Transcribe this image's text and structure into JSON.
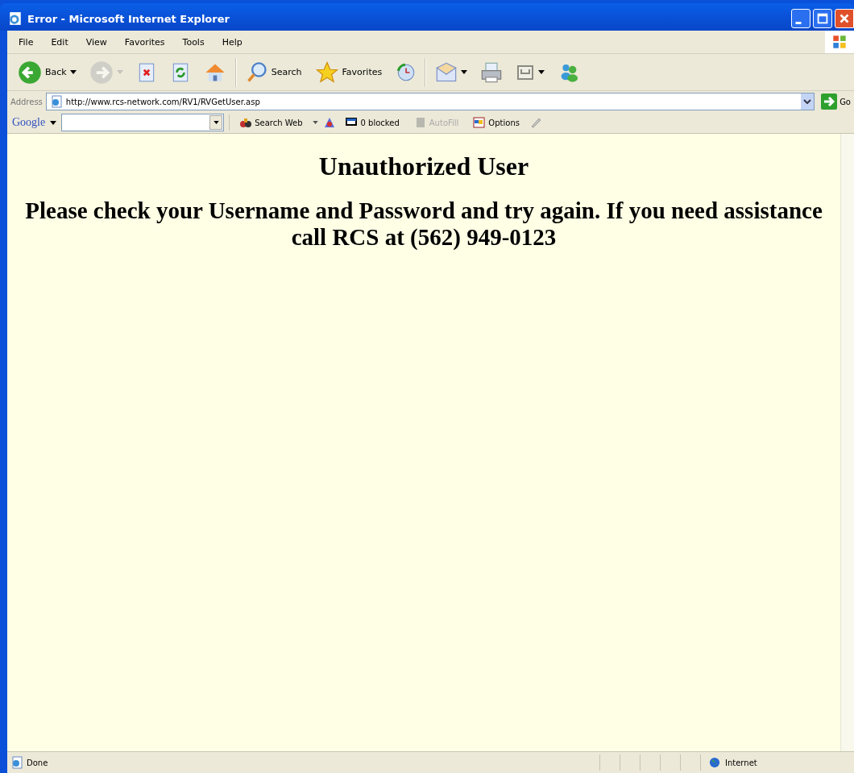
{
  "window": {
    "title": "Error - Microsoft Internet Explorer"
  },
  "menu": [
    "File",
    "Edit",
    "View",
    "Favorites",
    "Tools",
    "Help"
  ],
  "toolbar": [
    {
      "kind": "back",
      "label": "Back",
      "disabled": false,
      "dropdown": true
    },
    {
      "kind": "forward",
      "disabled": true,
      "dropdown": true
    },
    {
      "kind": "stop",
      "disabled": false,
      "dropdown": false
    },
    {
      "kind": "refresh",
      "disabled": false,
      "dropdown": false
    },
    {
      "kind": "home",
      "disabled": false,
      "dropdown": false
    },
    {
      "kind": "search",
      "label": "Search",
      "disabled": false,
      "dropdown": false
    },
    {
      "kind": "favorites",
      "label": "Favorites",
      "disabled": false,
      "dropdown": false
    },
    {
      "kind": "history",
      "disabled": false,
      "dropdown": false
    },
    {
      "kind": "mail",
      "disabled": false,
      "dropdown": true
    },
    {
      "kind": "print",
      "disabled": false,
      "dropdown": false
    },
    {
      "kind": "edit",
      "disabled": false,
      "dropdown": true
    },
    {
      "kind": "messenger",
      "disabled": false,
      "dropdown": false
    }
  ],
  "address_bar": {
    "label": "Address",
    "value": "http://www.rcs-network.com/RV1/RVGetUser.asp",
    "go": "Go"
  },
  "google_toolbar": {
    "logo": "Google",
    "search_web": "Search Web",
    "popups": "0 blocked",
    "autofill": "AutoFill",
    "options": "Options"
  },
  "page": {
    "heading": "Unauthorized User",
    "message": "Please check your Username and Password and try again. If you need assistance call RCS at (562) 949-0123"
  },
  "status_bar": {
    "text": "Done",
    "zone": "Internet"
  }
}
